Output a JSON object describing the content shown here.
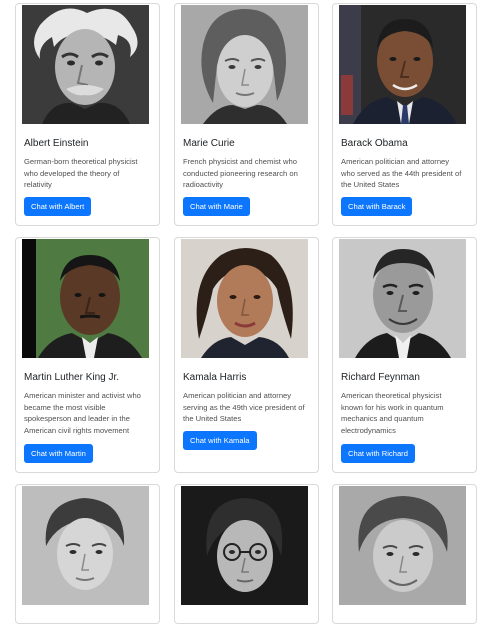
{
  "cards": [
    {
      "name": "Albert Einstein",
      "description": "German-born theoretical physicist who developed the theory of relativity",
      "button": "Chat with Albert",
      "photo": "albert-einstein-portrait"
    },
    {
      "name": "Marie Curie",
      "description": "French physicist and chemist who conducted pioneering research on radioactivity",
      "button": "Chat with Marie",
      "photo": "marie-curie-portrait"
    },
    {
      "name": "Barack Obama",
      "description": "American politician and attorney who served as the 44th president of the United States",
      "button": "Chat with Barack",
      "photo": "barack-obama-portrait"
    },
    {
      "name": "Martin Luther King Jr.",
      "description": "American minister and activist who became the most visible spokesperson and leader in the American civil rights movement",
      "button": "Chat with Martin",
      "photo": "martin-luther-king-portrait"
    },
    {
      "name": "Kamala Harris",
      "description": "American politician and attorney serving as the 49th vice president of the United States",
      "button": "Chat with Kamala",
      "photo": "kamala-harris-portrait"
    },
    {
      "name": "Richard Feynman",
      "description": "American theoretical physicist known for his work in quantum mechanics and quantum electrodynamics",
      "button": "Chat with Richard",
      "photo": "richard-feynman-portrait"
    },
    {
      "name": "",
      "description": "",
      "button": "",
      "photo": "woman-portrait"
    },
    {
      "name": "",
      "description": "",
      "button": "",
      "photo": "man-with-glasses-portrait"
    },
    {
      "name": "",
      "description": "",
      "button": "",
      "photo": "woman-short-hair-portrait"
    }
  ],
  "colors": {
    "button": "#0d76ff",
    "card_border": "#d9d9d9"
  }
}
